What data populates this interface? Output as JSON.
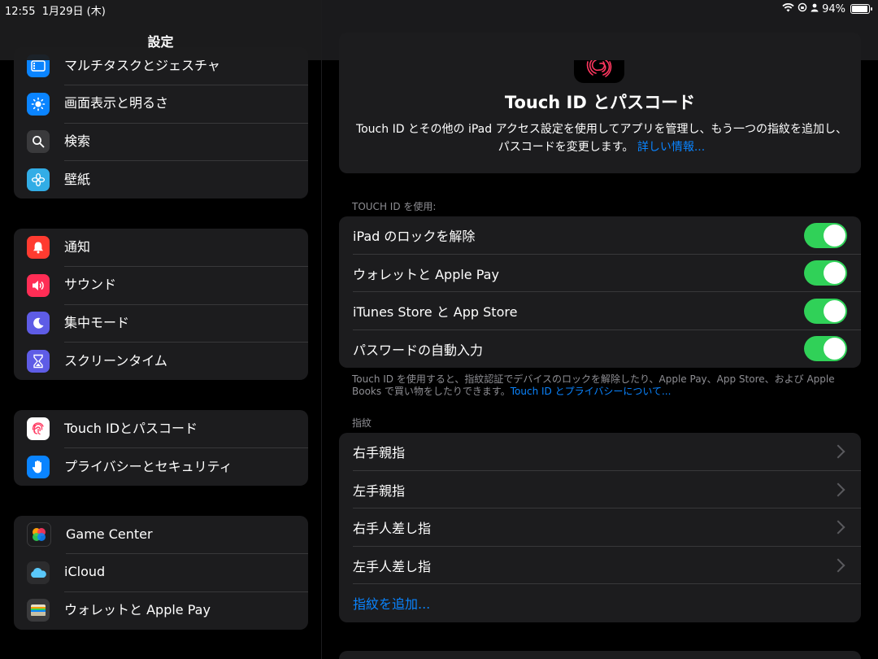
{
  "status": {
    "time": "12:55",
    "date": "1月29日 (木)",
    "battery": "94%",
    "battery_level": 0.94
  },
  "sidebar": {
    "title": "設定",
    "groups": [
      {
        "items": [
          {
            "label": "マルチタスクとジェスチャ",
            "icon": "multitask-icon",
            "color": "#0a84ff"
          },
          {
            "label": "画面表示と明るさ",
            "icon": "brightness-icon",
            "color": "#0a84ff"
          },
          {
            "label": "検索",
            "icon": "search-icon",
            "color": "#3a3a3c"
          },
          {
            "label": "壁紙",
            "icon": "wallpaper-icon",
            "color": "#32ade6"
          }
        ]
      },
      {
        "items": [
          {
            "label": "通知",
            "icon": "notification-icon",
            "color": "#ff3b30"
          },
          {
            "label": "サウンド",
            "icon": "sound-icon",
            "color": "#ff2d55"
          },
          {
            "label": "集中モード",
            "icon": "moon-icon",
            "color": "#5e5ce6"
          },
          {
            "label": "スクリーンタイム",
            "icon": "hourglass-icon",
            "color": "#5e5ce6"
          }
        ]
      },
      {
        "items": [
          {
            "label": "Touch IDとパスコード",
            "icon": "fingerprint-icon",
            "color": "#ff375f"
          },
          {
            "label": "プライバシーとセキュリティ",
            "icon": "hand-icon",
            "color": "#0a84ff"
          }
        ]
      },
      {
        "items": [
          {
            "label": "Game Center",
            "icon": "game-center-icon",
            "color": "#bf5af2"
          },
          {
            "label": "iCloud",
            "icon": "cloud-icon",
            "color": "#0a84ff"
          },
          {
            "label": "ウォレットと Apple Pay",
            "icon": "wallet-icon",
            "color": "#2c2c2e"
          }
        ]
      }
    ]
  },
  "main": {
    "hero": {
      "title": "Touch ID とパスコード",
      "description": "Touch ID とその他の iPad アクセス設定を使用してアプリを管理し、もう一つの指紋を追加し、パスコードを変更します。",
      "link": "詳しい情報..."
    },
    "use_touch_id": {
      "header": "TOUCH ID を使用:",
      "rows": [
        {
          "label": "iPad のロックを解除",
          "on": true
        },
        {
          "label": "ウォレットと Apple Pay",
          "on": true
        },
        {
          "label": "iTunes Store と App Store",
          "on": true
        },
        {
          "label": "パスワードの自動入力",
          "on": true
        }
      ],
      "footer": "Touch ID を使用すると、指紋認証でデバイスのロックを解除したり、Apple Pay、App Store、および Apple Books で買い物をしたりできます。",
      "footer_link": "Touch ID とプライバシーについて..."
    },
    "fingerprints": {
      "header": "指紋",
      "rows": [
        "右手親指",
        "左手親指",
        "右手人差し指",
        "左手人差し指"
      ],
      "add": "指紋を追加..."
    }
  }
}
